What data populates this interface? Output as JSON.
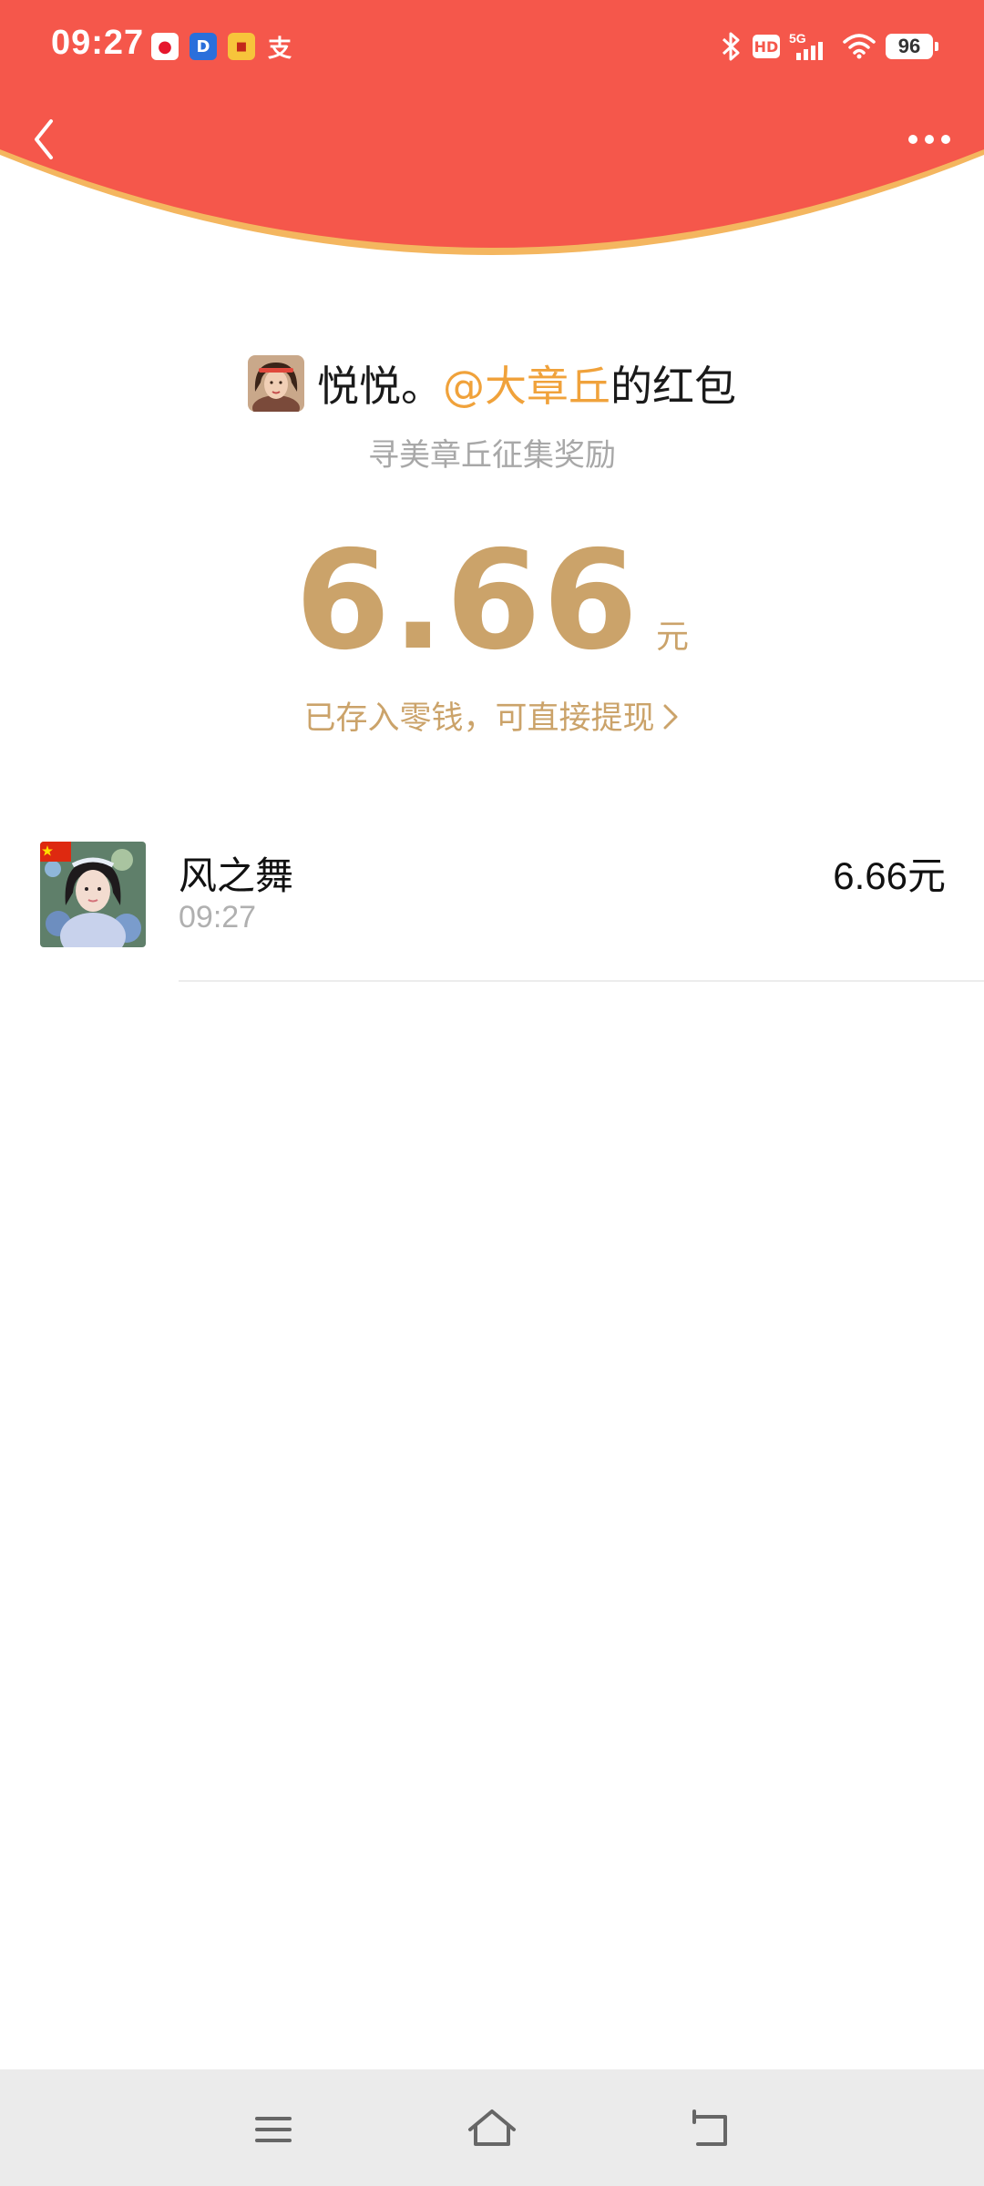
{
  "status_bar": {
    "time": "09:27",
    "notification_icons": [
      "weibo-icon",
      "dingtalk-icon",
      "news-icon",
      "alipay-icon"
    ],
    "battery_level": "96",
    "hd_label": "HD",
    "network_label": "5G"
  },
  "header": {
    "background_color": "#f5574b",
    "back_icon": "chevron-left-icon",
    "more_icon": "more-dots-icon"
  },
  "red_packet": {
    "sender_name": "悦悦。",
    "sender_mention": "@大章丘",
    "title_suffix": "的红包",
    "subtitle": "寻美章丘征集奖励",
    "amount": "6.66",
    "amount_unit": "元",
    "wallet_note": "已存入零钱，可直接提现"
  },
  "receivers": [
    {
      "name": "风之舞",
      "time": "09:27",
      "amount": "6.66元"
    }
  ],
  "bottom_nav": {
    "items": [
      "menu-icon",
      "home-icon",
      "back-icon"
    ]
  },
  "colors": {
    "header_red": "#f5574b",
    "gold": "#cba36a",
    "mention_orange": "#f0a23b"
  }
}
